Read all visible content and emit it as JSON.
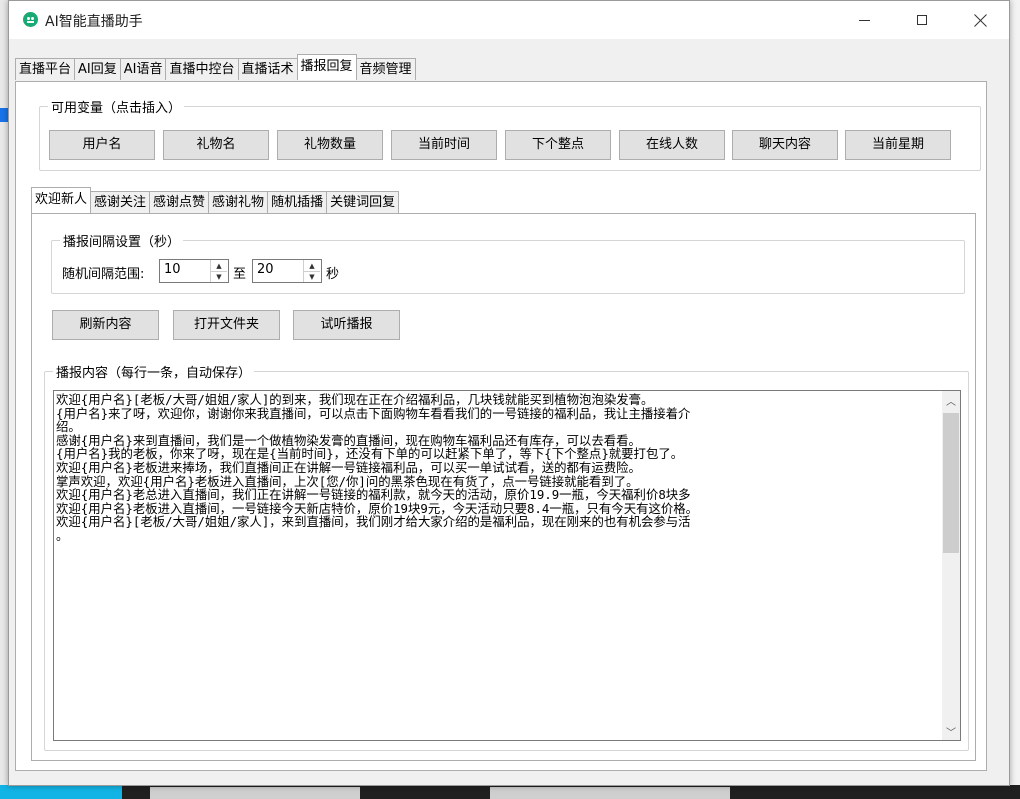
{
  "window": {
    "title": "AI智能直播助手"
  },
  "main_tabs": [
    "直播平台",
    "AI回复",
    "AI语音",
    "直播中控台",
    "直播话术",
    "播报回复",
    "音频管理"
  ],
  "variables": {
    "legend": "可用变量（点击插入）",
    "buttons": [
      "用户名",
      "礼物名",
      "礼物数量",
      "当前时间",
      "下个整点",
      "在线人数",
      "聊天内容",
      "当前星期"
    ]
  },
  "sub_tabs": [
    "欢迎新人",
    "感谢关注",
    "感谢点赞",
    "感谢礼物",
    "随机插播",
    "关键词回复"
  ],
  "interval": {
    "legend": "播报间隔设置（秒）",
    "range_label": "随机间隔范围:",
    "min": "10",
    "to": "至",
    "max": "20",
    "unit": "秒"
  },
  "actions": {
    "refresh": "刷新内容",
    "open_folder": "打开文件夹",
    "preview": "试听播报"
  },
  "content": {
    "legend": "播报内容（每行一条，自动保存）",
    "lines": [
      "欢迎{用户名}[老板/大哥/姐姐/家人]的到来，我们现在正在介绍福利品，几块钱就能买到植物泡泡染发膏。",
      "{用户名}来了呀，欢迎你，谢谢你来我直播间，可以点击下面购物车看看我们的一号链接的福利品，我让主播接着介",
      "绍。",
      "感谢{用户名}来到直播间，我们是一个做植物染发膏的直播间，现在购物车福利品还有库存，可以去看看。",
      "{用户名}我的老板，你来了呀，现在是{当前时间}，还没有下单的可以赶紧下单了，等下{下个整点}就要打包了。",
      "欢迎{用户名}老板进来捧场，我们直播间正在讲解一号链接福利品，可以买一单试试看，送的都有运费险。",
      "掌声欢迎，欢迎{用户名}老板进入直播间，上次[您/你]问的黑茶色现在有货了，点一号链接就能看到了。",
      "欢迎{用户名}老总进入直播间，我们正在讲解一号链接的福利款，就今天的活动，原价19.9一瓶，今天福利价8块多",
      "欢迎{用户名}老板进入直播间，一号链接今天新店特价，原价19块9元，今天活动只要8.4一瓶，只有今天有这价格。",
      "欢迎{用户名}[老板/大哥/姐姐/家人]，来到直播间，我们刚才给大家介绍的是福利品，现在刚来的也有机会参与活",
      "。"
    ]
  },
  "icons": {
    "app": "robot-face-icon",
    "minimize": "minimize-icon",
    "maximize": "maximize-icon",
    "close": "close-icon",
    "spin_up": "chevron-up-icon",
    "spin_down": "chevron-down-icon",
    "scroll_up": "scroll-up-icon",
    "scroll_down": "scroll-down-icon"
  },
  "colors": {
    "app_icon": "#19a974",
    "window_bg": "#f0f0f0",
    "button_bg": "#e1e1e1"
  }
}
